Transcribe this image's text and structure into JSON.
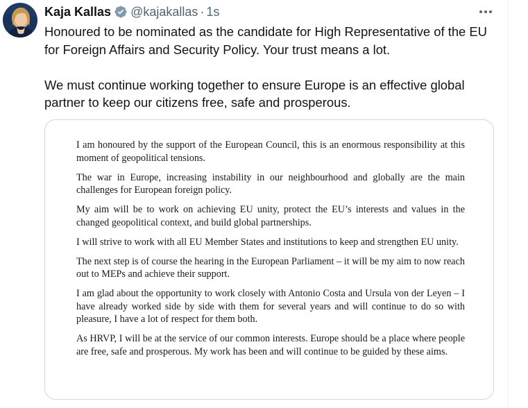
{
  "tweet": {
    "author": {
      "display_name": "Kaja Kallas",
      "handle": "@kajakallas",
      "verified": true
    },
    "separator": "·",
    "timestamp": "1s",
    "more_icon": "more-horizontal-icon",
    "paragraphs": [
      "Honoured to be nominated as the candidate for High Representative of the EU for Foreign Affairs and Security Policy. Your trust means a lot.",
      "We must continue working together to ensure Europe is an effective global partner to keep our citizens free, safe and prosperous."
    ],
    "media": {
      "statement_paragraphs": [
        "I am honoured by the support of the European Council, this is an enormous responsibility at this moment of geopolitical tensions.",
        "The war in Europe, increasing instability in our neighbourhood and globally are the main challenges for European foreign policy.",
        "My aim will be to work on achieving EU unity, protect the EU’s interests and values in the changed geopolitical context, and build global partnerships.",
        "I will strive to work with all EU Member States and institutions to keep and strengthen EU unity.",
        "The next step is of course the hearing in the European Parliament – it will be my aim to now reach out to MEPs and achieve their support.",
        "I am glad about the opportunity to work closely with Antonio Costa and Ursula von der Leyen – I have already worked side by side with them for several years and will continue to do so with pleasure, I have a lot of respect for them both.",
        "As HRVP, I will be at the service of our common interests. Europe should be a place where people are free, safe and prosperous. My work has been and will continue to be guided by these aims."
      ]
    }
  },
  "colors": {
    "text_primary": "#0f1419",
    "text_secondary": "#536471",
    "verified_badge": "#829aab",
    "card_border": "#cfd9de"
  }
}
